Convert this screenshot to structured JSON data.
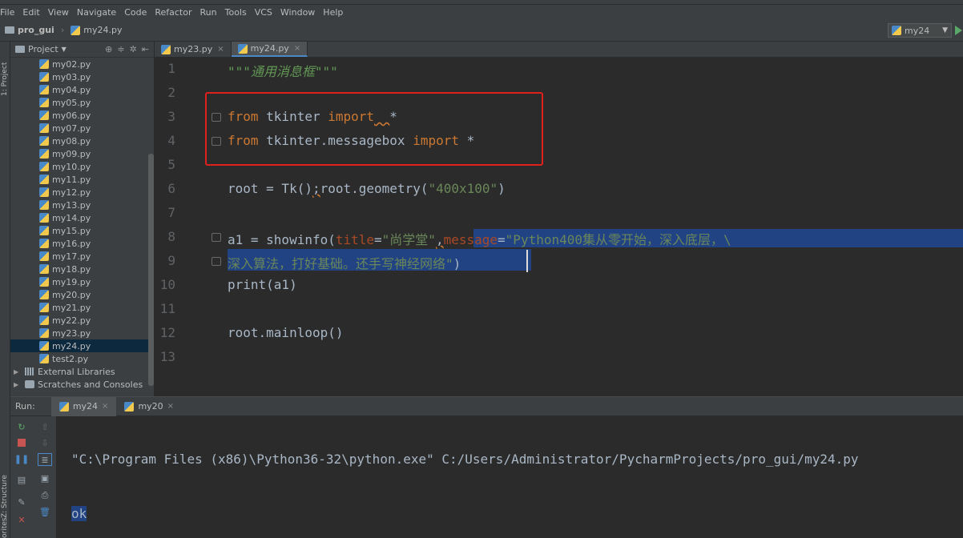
{
  "menu": [
    "File",
    "Edit",
    "View",
    "Navigate",
    "Code",
    "Refactor",
    "Run",
    "Tools",
    "VCS",
    "Window",
    "Help"
  ],
  "breadcrumb": {
    "project": "pro_gui",
    "file": "my24.py"
  },
  "run_config": {
    "label": "my24"
  },
  "left_strip": {
    "project_label": "1: Project",
    "structure_label": "Z: Structure",
    "favorites_label": "orites"
  },
  "project_panel": {
    "title": "Project",
    "files": [
      "my02.py",
      "my03.py",
      "my04.py",
      "my05.py",
      "my06.py",
      "my07.py",
      "my08.py",
      "my09.py",
      "my10.py",
      "my11.py",
      "my12.py",
      "my13.py",
      "my14.py",
      "my15.py",
      "my16.py",
      "my17.py",
      "my18.py",
      "my19.py",
      "my20.py",
      "my21.py",
      "my22.py",
      "my23.py",
      "my24.py",
      "test2.py"
    ],
    "selected_file": "my24.py",
    "groups": [
      "External Libraries",
      "Scratches and Consoles"
    ]
  },
  "editor_tabs": [
    {
      "label": "my23.py",
      "active": false
    },
    {
      "label": "my24.py",
      "active": true
    }
  ],
  "editor": {
    "line_numbers": [
      "1",
      "2",
      "3",
      "4",
      "5",
      "6",
      "7",
      "8",
      "9",
      "10",
      "11",
      "12",
      "13"
    ],
    "line1_doc": "\"\"\"通用消息框\"\"\"",
    "line3": {
      "kw_from": "from",
      "module": " tkinter ",
      "kw_import": "import",
      "space": "  ",
      "star": "*"
    },
    "line4": {
      "kw_from": "from",
      "module": " tkinter.messagebox ",
      "kw_import": "import",
      "star": " *"
    },
    "line6": {
      "a": "root = Tk()",
      "semi": ";",
      "b": "root.geometry(",
      "str": "\"400x100\"",
      "c": ")"
    },
    "line8": {
      "a": "a1 = showinfo(",
      "p1": "title",
      "eq1": "=",
      "s1": "\"尚学堂\"",
      "comma": ",",
      "p2": "message",
      "eq2": "=",
      "s2": "\"Python400集从零开始，深入底层，\\"
    },
    "line9": {
      "s": "深入算法，打好基础。还手写神经网络\"",
      "paren": ")"
    },
    "line10": "print(a1)",
    "line12": "root.mainloop()"
  },
  "run_panel": {
    "label": "Run:",
    "tabs": [
      {
        "label": "my24",
        "active": true
      },
      {
        "label": "my20",
        "active": false
      }
    ],
    "console": [
      "\"C:\\Program Files (x86)\\Python36-32\\python.exe\" C:/Users/Administrator/PycharmProjects/pro_gui/my24.py",
      "ok"
    ]
  },
  "colors": {
    "keyword": "#cc7832",
    "string": "#6a8759",
    "selection": "#214283",
    "annotation_box": "#e0201c"
  }
}
